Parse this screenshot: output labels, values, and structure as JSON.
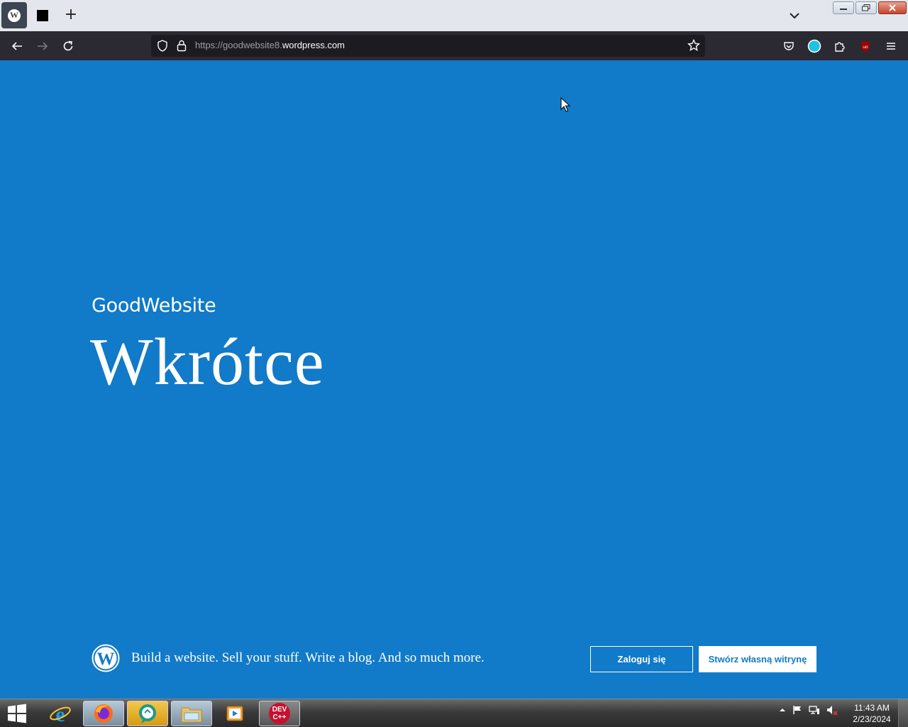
{
  "browser": {
    "tab_new_label": "+",
    "url_prefix": "https://goodwebsite8.",
    "url_domain": "wordpress.com",
    "favicon_letter": "W"
  },
  "page": {
    "site_name": "GoodWebsite",
    "headline": "Wkrótce",
    "tagline": "Build a website. Sell your stuff. Write a blog. And so much more.",
    "login_label": "Zaloguj się",
    "create_label": "Stwórz własną witrynę",
    "background_color": "#117ac9"
  },
  "taskbar": {
    "apps": [
      "internet-explorer",
      "firefox",
      "chat-app",
      "file-explorer",
      "media-player",
      "dev-cpp"
    ],
    "devcpp_label_top": "DEV",
    "devcpp_label_bottom": "C++",
    "clock_time": "11:43 AM",
    "clock_date": "2/23/2024"
  }
}
